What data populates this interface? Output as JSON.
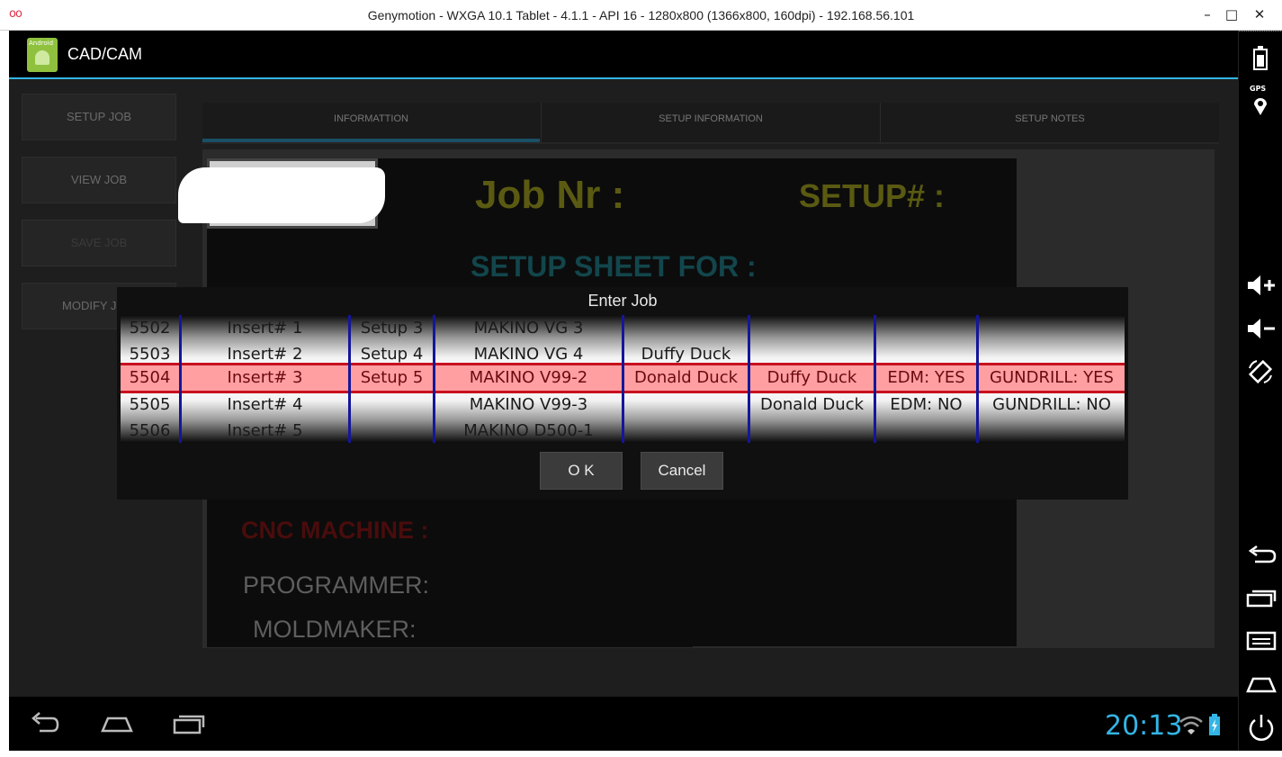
{
  "window": {
    "title": "Genymotion - WXGA 10.1 Tablet - 4.1.1 - API 16 - 1280x800 (1366x800, 160dpi) - 192.168.56.101",
    "logo": "oo",
    "minimize": "–",
    "maximize": "□",
    "close": "✕"
  },
  "app": {
    "title": "CAD/CAM",
    "icon_label": "Android"
  },
  "side_buttons": [
    {
      "label": "SETUP JOB",
      "enabled": true
    },
    {
      "label": "VIEW JOB",
      "enabled": true
    },
    {
      "label": "SAVE JOB",
      "enabled": false
    },
    {
      "label": "MODIFY J",
      "enabled": true
    }
  ],
  "tabs": [
    {
      "label": "INFORMATTION",
      "selected": true
    },
    {
      "label": "SETUP INFORMATION",
      "selected": false
    },
    {
      "label": "SETUP NOTES",
      "selected": false
    }
  ],
  "sheet": {
    "job_nr_label": "Job Nr :",
    "setup_label": "SETUP# :",
    "sheet_for_label": "SETUP SHEET FOR :",
    "cnc_label": "CNC MACHINE :",
    "programmer_label": "PROGRAMMER:",
    "moldmaker_label": "MOLDMAKER:"
  },
  "dialog": {
    "title": "Enter  Job",
    "ok_label": "O K",
    "cancel_label": "Cancel",
    "columns": [
      {
        "name": "job",
        "values": [
          "5502",
          "5503",
          "5504",
          "5505",
          "5506"
        ]
      },
      {
        "name": "insert",
        "values": [
          "Insert# 1",
          "Insert# 2",
          "Insert# 3",
          "Insert# 4",
          "Insert# 5"
        ]
      },
      {
        "name": "setup",
        "values": [
          "Setup 3",
          "Setup 4",
          "Setup 5",
          "",
          ""
        ]
      },
      {
        "name": "machine",
        "values": [
          "MAKINO VG 3",
          "MAKINO VG 4",
          "MAKINO V99-2",
          "MAKINO V99-3",
          "MAKINO D500-1"
        ]
      },
      {
        "name": "programmer",
        "values": [
          "",
          "Duffy Duck",
          "Donald Duck",
          "",
          ""
        ]
      },
      {
        "name": "moldmaker",
        "values": [
          "",
          "",
          "Duffy Duck",
          "Donald Duck",
          ""
        ]
      },
      {
        "name": "edm",
        "values": [
          "",
          "",
          "EDM: YES",
          "EDM: NO",
          ""
        ]
      },
      {
        "name": "gundrill",
        "values": [
          "",
          "",
          "GUNDRILL: YES",
          "GUNDRILL: NO",
          ""
        ]
      }
    ],
    "selected_index": 2
  },
  "status": {
    "time": "20:13"
  },
  "icons": {
    "nav": [
      "back-icon",
      "home-icon",
      "recent-apps-icon"
    ],
    "status": [
      "wifi-icon",
      "battery-charging-icon"
    ],
    "emulator_panel": [
      "battery-icon",
      "gps-icon",
      "volume-up-icon",
      "volume-down-icon",
      "rotate-icon",
      "back-icon",
      "recent-apps-icon",
      "menu-icon",
      "home-icon",
      "power-icon"
    ],
    "gps_label": "GPS"
  },
  "colors": {
    "accent": "#33b5e5",
    "selection": "#ff9fa2",
    "selection_border": "#c8101e",
    "column_divider": "#15169a"
  }
}
